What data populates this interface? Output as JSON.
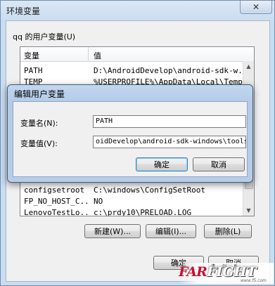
{
  "outer": {
    "title": "环境变量",
    "close_glyph": "✕",
    "group_label": "qq 的用户变量(U)",
    "columns": [
      "变量",
      "值"
    ],
    "rows": [
      {
        "name": "PATH",
        "value": "D:\\AndroidDevelop\\android-sdk-w..."
      },
      {
        "name": "TEMP",
        "value": "%USERPROFILE%\\AppData\\Local\\Temp"
      },
      {
        "name": "configsetroot",
        "value": "C:\\windows\\ConfigSetRoot"
      },
      {
        "name": "FP_NO_HOST_C...",
        "value": "NO"
      },
      {
        "name": "LenovoTestLo...",
        "value": "c:\\prdy10\\PRELOAD.LOG"
      }
    ],
    "buttons": {
      "new": "新建(W)...",
      "edit": "编辑(I)...",
      "delete": "删除(L)"
    },
    "footer": {
      "ok": "确定",
      "cancel": "取消"
    }
  },
  "dialog": {
    "title": "编辑用户变量",
    "name_label": "变量名(N):",
    "value_label": "变量值(V):",
    "name_value": "PATH",
    "value_value": "oidDevelop\\android-sdk-windows\\tools",
    "ok": "确定",
    "cancel": "取消"
  },
  "watermark": {
    "far": "FAR",
    "fight": "FIGHT",
    "small": "清 剑 系",
    "url": "www.f5.com"
  },
  "colors": {
    "accent_red": "#c8102e",
    "title_blue": "#b6cde9"
  }
}
